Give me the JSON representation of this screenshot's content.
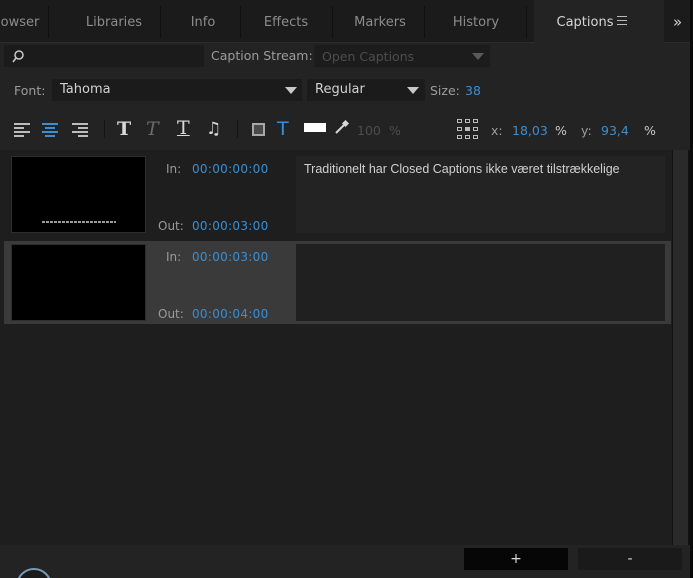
{
  "tabs": [
    {
      "label": "owser",
      "active": false
    },
    {
      "label": "Libraries",
      "active": false
    },
    {
      "label": "Info",
      "active": false
    },
    {
      "label": "Effects",
      "active": false
    },
    {
      "label": "Markers",
      "active": false
    },
    {
      "label": "History",
      "active": false
    },
    {
      "label": "Captions",
      "active": true
    }
  ],
  "tab_overflow": "»",
  "search": {
    "value": "",
    "icon": "search-icon"
  },
  "caption_stream": {
    "label": "Caption Stream:",
    "value": "Open Captions"
  },
  "font": {
    "label": "Font:",
    "value": "Tahoma"
  },
  "style": {
    "value": "Regular"
  },
  "size": {
    "label": "Size:",
    "value": "38"
  },
  "toolbar": {
    "bold_glyph": "T",
    "italic_glyph": "T",
    "underline_glyph": "T",
    "music_glyph": "♫",
    "text_color_glyph": "T",
    "opacity_value": "100",
    "opacity_unit": "%",
    "x_label": "x:",
    "x_value": "18,03",
    "x_unit": "%",
    "y_label": "y:",
    "y_value": "93,4",
    "y_unit": "%"
  },
  "captions": [
    {
      "in_label": "In:",
      "in_tc": "00:00:00:00",
      "out_label": "Out:",
      "out_tc": "00:00:03:00",
      "text": "Traditionelt har Closed Captions ikke været tilstrækkelige",
      "selected": false
    },
    {
      "in_label": "In:",
      "in_tc": "00:00:03:00",
      "out_label": "Out:",
      "out_tc": "00:00:04:00",
      "text": "",
      "selected": true
    }
  ],
  "buttons": {
    "add": "+",
    "remove": "-"
  },
  "colors": {
    "accent": "#3a8fd4",
    "panel": "#232323",
    "background": "#1a1a1a"
  }
}
